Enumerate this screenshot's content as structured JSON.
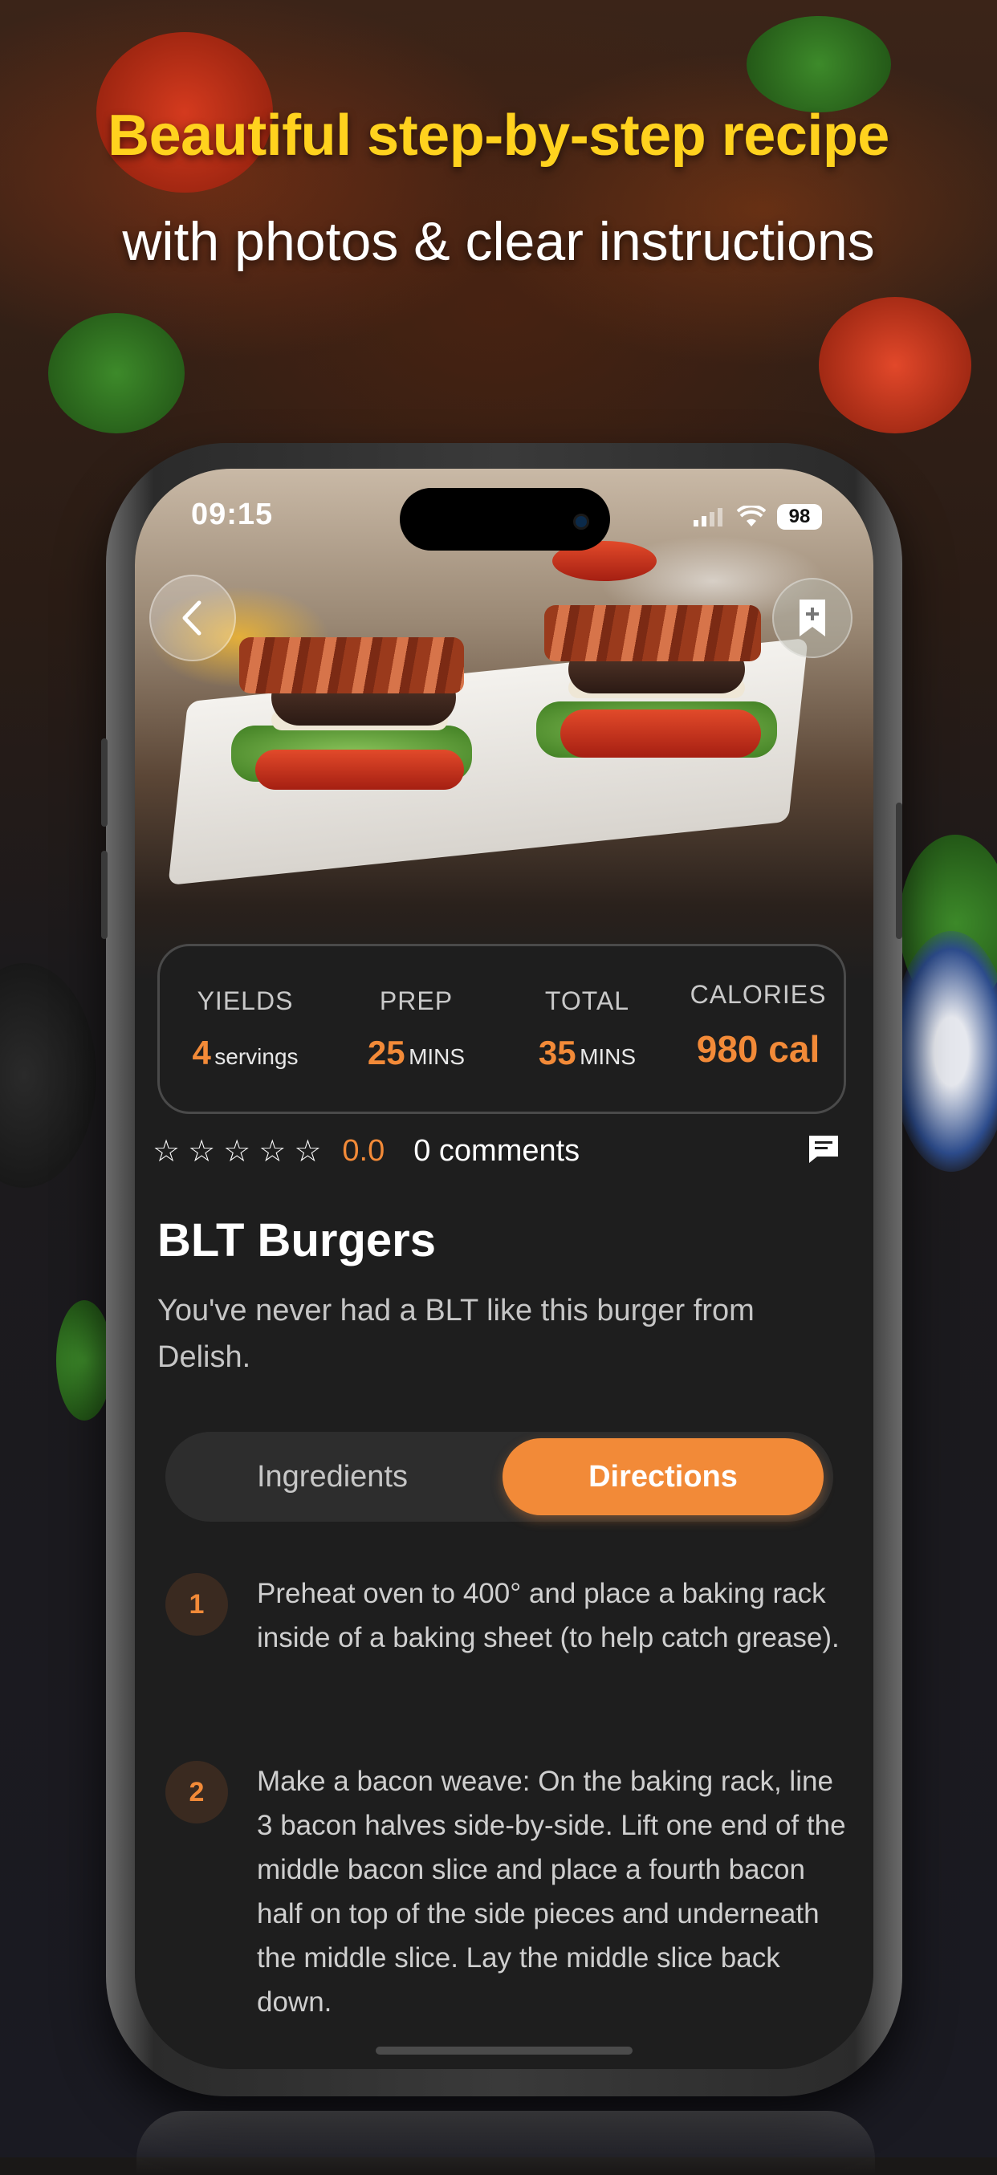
{
  "headline": {
    "line1": "Beautiful step-by-step recipe",
    "line2": "with photos & clear instructions"
  },
  "status_bar": {
    "time": "09:15",
    "battery": "98"
  },
  "icons": {
    "back": "chevron-left-icon",
    "bookmark": "bookmark-add-icon",
    "comment": "comment-icon",
    "star": "star-outline-icon",
    "wifi": "wifi-icon",
    "signal": "signal-icon"
  },
  "stats": [
    {
      "label": "YIELDS",
      "value": "4",
      "unit": "servings"
    },
    {
      "label": "PREP",
      "value": "25",
      "unit": "MINS"
    },
    {
      "label": "TOTAL",
      "value": "35",
      "unit": "MINS"
    },
    {
      "label": "CALORIES",
      "value": "980 cal",
      "unit": ""
    }
  ],
  "rating": {
    "value": "0.0",
    "stars": 0,
    "comments": "0 comments"
  },
  "recipe": {
    "title": "BLT Burgers",
    "description": "You've never had a BLT like this burger from Delish."
  },
  "tabs": {
    "ingredients": "Ingredients",
    "directions": "Directions",
    "active": "directions"
  },
  "steps": [
    {
      "number": "1",
      "text": "Preheat oven to 400° and place a baking rack inside of a baking sheet (to help catch grease)."
    },
    {
      "number": "2",
      "text": "Make a bacon weave: On the baking rack, line 3 bacon halves side-by-side. Lift one end of the middle bacon slice and place a fourth bacon half on top of the side pieces and underneath the middle slice. Lay the middle slice back down."
    }
  ],
  "colors": {
    "accent": "#f28a38",
    "headline_yellow": "#ffd21e",
    "screen_bg": "#1e1e1e"
  }
}
